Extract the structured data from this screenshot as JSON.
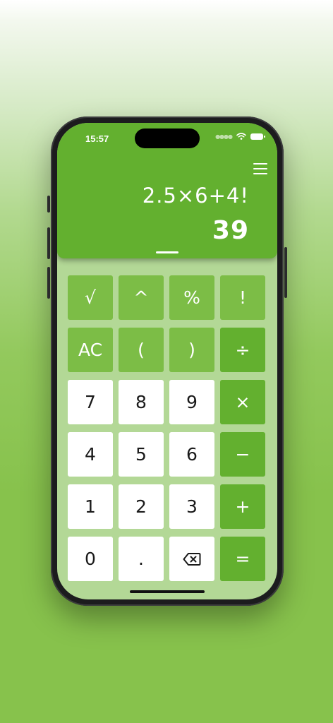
{
  "status_bar": {
    "time": "15:57"
  },
  "display": {
    "expression": "2.5×6+4!",
    "result": "39",
    "menu_icon": "hamburger-menu-icon"
  },
  "keypad": {
    "rows": [
      [
        {
          "label": "√",
          "type": "fn",
          "name": "sqrt-button"
        },
        {
          "label": "^",
          "type": "fn",
          "name": "power-button"
        },
        {
          "label": "%",
          "type": "fn",
          "name": "percent-button"
        },
        {
          "label": "!",
          "type": "fn",
          "name": "factorial-button"
        }
      ],
      [
        {
          "label": "AC",
          "type": "fn",
          "name": "all-clear-button"
        },
        {
          "label": "(",
          "type": "fn",
          "name": "open-paren-button"
        },
        {
          "label": ")",
          "type": "fn",
          "name": "close-paren-button"
        },
        {
          "label": "÷",
          "type": "op",
          "name": "divide-button"
        }
      ],
      [
        {
          "label": "7",
          "type": "num",
          "name": "digit-7-button"
        },
        {
          "label": "8",
          "type": "num",
          "name": "digit-8-button"
        },
        {
          "label": "9",
          "type": "num",
          "name": "digit-9-button"
        },
        {
          "label": "×",
          "type": "op",
          "name": "multiply-button"
        }
      ],
      [
        {
          "label": "4",
          "type": "num",
          "name": "digit-4-button"
        },
        {
          "label": "5",
          "type": "num",
          "name": "digit-5-button"
        },
        {
          "label": "6",
          "type": "num",
          "name": "digit-6-button"
        },
        {
          "label": "−",
          "type": "op",
          "name": "subtract-button"
        }
      ],
      [
        {
          "label": "1",
          "type": "num",
          "name": "digit-1-button"
        },
        {
          "label": "2",
          "type": "num",
          "name": "digit-2-button"
        },
        {
          "label": "3",
          "type": "num",
          "name": "digit-3-button"
        },
        {
          "label": "+",
          "type": "op",
          "name": "add-button"
        }
      ],
      [
        {
          "label": "0",
          "type": "num",
          "name": "digit-0-button"
        },
        {
          "label": ".",
          "type": "num",
          "name": "decimal-point-button"
        },
        {
          "label": "",
          "type": "num",
          "name": "backspace-button",
          "icon": "backspace-icon"
        },
        {
          "label": "=",
          "type": "op",
          "name": "equals-button"
        }
      ]
    ]
  },
  "colors": {
    "display_bg": "#63b02f",
    "function_key_bg": "#7cbd46",
    "operator_key_bg": "#63b02f",
    "number_key_bg": "#ffffff",
    "keypad_bg": "#b3d896",
    "page_bg": "#87c24c"
  }
}
